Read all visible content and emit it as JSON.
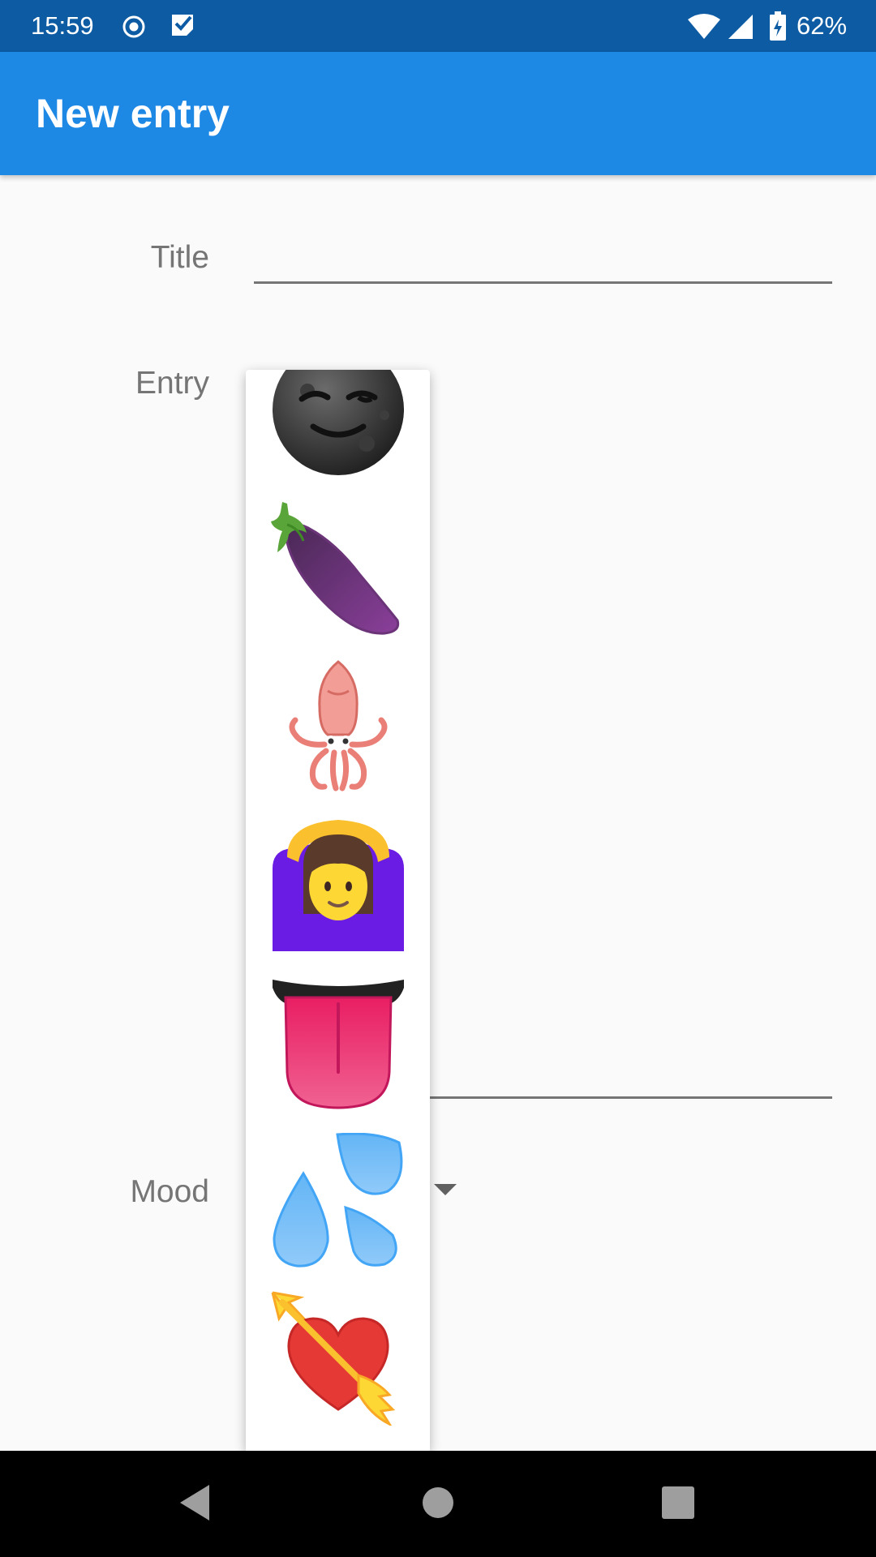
{
  "status_bar": {
    "time": "15:59",
    "battery_text": "62%",
    "background": "#0c5ba3",
    "icons": [
      "record-icon",
      "checkmark-app-icon",
      "wifi-icon",
      "cell-signal-icon",
      "battery-charging-icon"
    ]
  },
  "app_bar": {
    "title": "New entry",
    "background": "#1e88e5"
  },
  "form": {
    "title_label": "Title",
    "title_value": "",
    "entry_label": "Entry",
    "entry_value": "",
    "mood_label": "Mood",
    "mood_selected": ""
  },
  "mood_dropdown": {
    "options": [
      {
        "emoji": "🌚",
        "icon": "new-moon-face-icon"
      },
      {
        "emoji": "🍆",
        "icon": "eggplant-icon"
      },
      {
        "emoji": "🦑",
        "icon": "squid-icon"
      },
      {
        "emoji": "🙆‍♀️",
        "icon": "woman-gesturing-ok-icon"
      },
      {
        "emoji": "👅",
        "icon": "tongue-icon"
      },
      {
        "emoji": "💦",
        "icon": "sweat-droplets-icon"
      },
      {
        "emoji": "💘",
        "icon": "heart-with-arrow-icon"
      }
    ]
  },
  "nav_bar": {
    "buttons": [
      "back-icon",
      "home-icon",
      "recents-icon"
    ]
  }
}
